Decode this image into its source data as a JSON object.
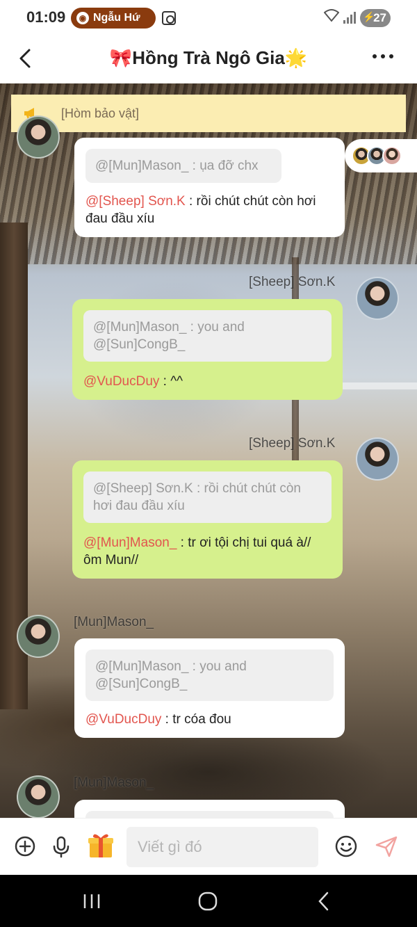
{
  "status_bar": {
    "time": "01:09",
    "app_pill": "Ngẫu Hứ",
    "battery": "27"
  },
  "header": {
    "title": "🎀Hồng Trà Ngô Gia🌟"
  },
  "announcement": {
    "text": "[Hòm bảo vật]"
  },
  "messages": [
    {
      "sender": "",
      "side": "left",
      "quote": "@[Mun]Mason_ : ụa đỡ chx",
      "mention": "@[Sheep] Sơn.K",
      "text": " : rồi chút chút còn hơi đau đầu xíu"
    },
    {
      "sender": "[Sheep] Sơn.K",
      "side": "right",
      "quote": "@[Mun]Mason_ : you and @[Sun]CongB_",
      "mention": "@VuDucDuy",
      "text": " : ^^"
    },
    {
      "sender": "[Sheep] Sơn.K",
      "side": "right",
      "quote": "@[Sheep] Sơn.K : rồi chút chút còn hơi đau đầu xíu",
      "mention": "@[Mun]Mason_",
      "text": " : tr ơi tội chị tui quá à// ôm Mun//"
    },
    {
      "sender": "[Mun]Mason_",
      "side": "left",
      "quote": "@[Mun]Mason_ : you and @[Sun]CongB_",
      "mention": "@VuDucDuy",
      "text": " : tr cóa đou"
    },
    {
      "sender": "[Mun]Mason_",
      "side": "left",
      "quote": "",
      "mention": "",
      "text": ""
    }
  ],
  "input": {
    "placeholder": "Viết gì đó"
  },
  "icons": {
    "back": "chevron-left-icon",
    "more": "more-dots-icon",
    "megaphone": "megaphone-icon",
    "add": "plus-circle-icon",
    "mic": "microphone-icon",
    "gift": "gift-icon",
    "emoji": "smile-icon",
    "send": "send-icon"
  },
  "colors": {
    "mention": "#e2554e",
    "bubble_outgoing": "#d6f08d",
    "announcement_bg": "#fbedb2",
    "pill_bg": "#8a3b0e"
  }
}
